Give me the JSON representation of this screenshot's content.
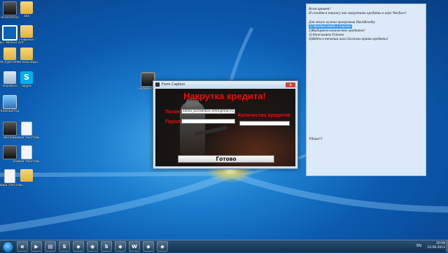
{
  "desktop": {
    "icons": [
      {
        "label": "Shameman",
        "glyph": "dark"
      },
      {
        "label": "ава",
        "glyph": "folder"
      },
      {
        "label": "CNET NOD32 Antivirus",
        "glyph": "circle"
      },
      {
        "label": "новинки",
        "glyph": "folder"
      },
      {
        "label": "НЕ УДАЛЯТЬ",
        "glyph": "folder"
      },
      {
        "label": "ляп.мой.обрц",
        "glyph": "folder"
      },
      {
        "label": "Корзина",
        "glyph": "bin"
      },
      {
        "label": "Skype",
        "glyph": "skype"
      },
      {
        "label": "Компьютер",
        "glyph": "pc"
      },
      {
        "label": "",
        "glyph": "dark"
      },
      {
        "label": "Warface",
        "glyph": "dark"
      },
      {
        "label": "Новый текстовый",
        "glyph": "doc"
      },
      {
        "label": "",
        "glyph": "dark"
      },
      {
        "label": "Новый текстовый",
        "glyph": "doc"
      },
      {
        "label": "",
        "glyph": "folder"
      },
      {
        "label": "Новый текстовый",
        "glyph": "doc"
      },
      {
        "label": "",
        "glyph": "doc"
      },
      {
        "label": "HackKredity",
        "glyph": "dark"
      }
    ]
  },
  "dialog": {
    "window_title": "Form Caption",
    "close_label": "x",
    "heading": "Накрутка кредита!",
    "login_label": "Логин",
    "login_value": "sasha_kursatskov-2005@mail.ru",
    "password_label": "Пароль",
    "password_value": "",
    "credits_label": "Количество кредитов",
    "credits_value": "",
    "submit_label": "Готово"
  },
  "notepad": {
    "lines": [
      "Всем привет!",
      "И сегодня я покажу как накрутить кредиты в игре Warface!",
      "",
      "Для этого нужна программа HackKredity",
      "1) Вводим емейл и пароль!",
      "2)Выбираем количество кредитов!",
      "3) Нажимаем Готово",
      "4)Ждём в течении часа должны крити кредиты!"
    ],
    "highlighted_line": 4,
    "signature": "Удачи!!!"
  },
  "taskbar": {
    "buttons": [
      {
        "name": "ie",
        "glyph": "e"
      },
      {
        "name": "media-player",
        "glyph": "▶"
      },
      {
        "name": "explorer",
        "glyph": "▤"
      },
      {
        "name": "skype",
        "glyph": "S"
      },
      {
        "name": "game-1",
        "glyph": "◆"
      },
      {
        "name": "nod32",
        "glyph": "◉"
      },
      {
        "name": "skype-2",
        "glyph": "S"
      },
      {
        "name": "game-2",
        "glyph": "◆"
      },
      {
        "name": "word",
        "glyph": "W"
      },
      {
        "name": "game-3",
        "glyph": "◆"
      },
      {
        "name": "game-4",
        "glyph": "◆"
      }
    ],
    "language": "EN",
    "time": "10:09",
    "date": "10.08.2013"
  },
  "colors": {
    "accent_red": "#e11212",
    "selection_blue": "#3399ff"
  }
}
